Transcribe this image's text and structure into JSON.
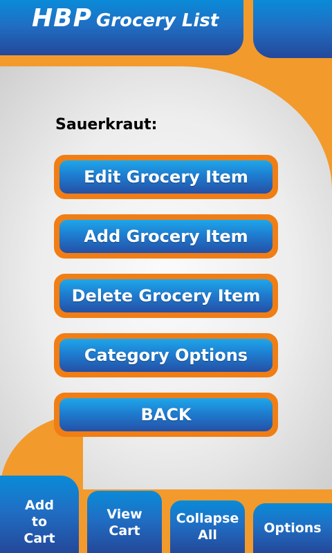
{
  "header": {
    "title_big": "HBP",
    "title_small": "Grocery List"
  },
  "main": {
    "item_name": "Sauerkraut:",
    "buttons": [
      "Edit Grocery Item",
      "Add Grocery Item",
      "Delete Grocery Item",
      "Category Options",
      "BACK"
    ]
  },
  "tabs": [
    {
      "lines": [
        "Add",
        "to",
        "Cart"
      ]
    },
    {
      "lines": [
        "View",
        "Cart"
      ]
    },
    {
      "lines": [
        "Collapse",
        "All"
      ]
    },
    {
      "lines": [
        "Options"
      ]
    }
  ],
  "colors": {
    "accent_orange": "#f39a2c",
    "button_blue": "#1e7dd0"
  }
}
